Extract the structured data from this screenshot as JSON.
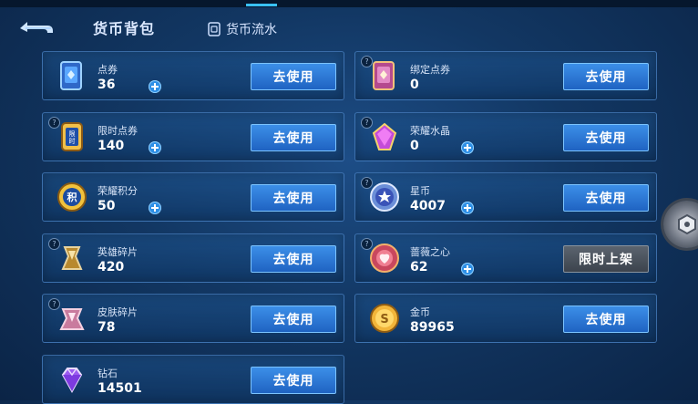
{
  "header": {
    "title": "货币背包",
    "flow_label": "货币流水",
    "back_icon": "back-arrow-icon",
    "flow_icon": "ledger-icon"
  },
  "use_label": "去使用",
  "limited_label": "限时上架",
  "currencies": [
    {
      "name": "点券",
      "amount": "36",
      "icon": "voucher-card-icon",
      "has_plus": true,
      "help": false,
      "action": "use"
    },
    {
      "name": "绑定点券",
      "amount": "0",
      "icon": "bound-voucher-icon",
      "has_plus": false,
      "help": true,
      "action": "use"
    },
    {
      "name": "限时点券",
      "amount": "140",
      "icon": "limited-voucher-icon",
      "has_plus": true,
      "help": true,
      "action": "use"
    },
    {
      "name": "荣耀水晶",
      "amount": "0",
      "icon": "glory-crystal-icon",
      "has_plus": true,
      "help": true,
      "action": "use"
    },
    {
      "name": "荣耀积分",
      "amount": "50",
      "icon": "glory-points-icon",
      "has_plus": true,
      "help": false,
      "action": "use"
    },
    {
      "name": "星币",
      "amount": "4007",
      "icon": "star-coin-icon",
      "has_plus": true,
      "help": true,
      "action": "use"
    },
    {
      "name": "英雄碎片",
      "amount": "420",
      "icon": "hero-shard-icon",
      "has_plus": false,
      "help": true,
      "action": "use"
    },
    {
      "name": "蔷薇之心",
      "amount": "62",
      "icon": "rose-heart-icon",
      "has_plus": true,
      "help": true,
      "action": "limited"
    },
    {
      "name": "皮肤碎片",
      "amount": "78",
      "icon": "skin-shard-icon",
      "has_plus": false,
      "help": true,
      "action": "use"
    },
    {
      "name": "金币",
      "amount": "89965",
      "icon": "gold-coin-icon",
      "has_plus": false,
      "help": false,
      "action": "use"
    },
    {
      "name": "钻石",
      "amount": "14501",
      "icon": "diamond-icon",
      "has_plus": false,
      "help": false,
      "action": "use"
    }
  ],
  "colors": {
    "accent_blue": "#2e8fe6",
    "button_blue": "#1f63c2",
    "card_border": "#629ee6",
    "background": "#123763"
  }
}
